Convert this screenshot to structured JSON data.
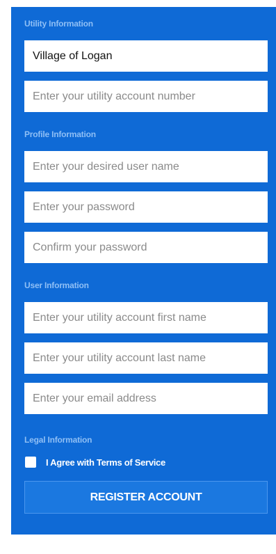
{
  "utility": {
    "title": "Utility Information",
    "provider_value": "Village of Logan",
    "account_placeholder": "Enter your utility account number"
  },
  "profile": {
    "title": "Profile Information",
    "username_placeholder": "Enter your desired user name",
    "password_placeholder": "Enter your password",
    "confirm_placeholder": "Confirm your password"
  },
  "user": {
    "title": "User Information",
    "first_name_placeholder": "Enter your utility account first name",
    "last_name_placeholder": "Enter your utility account last name",
    "email_placeholder": "Enter your email address"
  },
  "legal": {
    "title": "Legal Information",
    "agree_label": "I Agree with Terms of Service",
    "agree_checked": false
  },
  "register_label": "REGISTER ACCOUNT",
  "colors": {
    "panel": "#0f6ad6",
    "section_title": "#8fbff5",
    "button": "#1b78e0"
  }
}
